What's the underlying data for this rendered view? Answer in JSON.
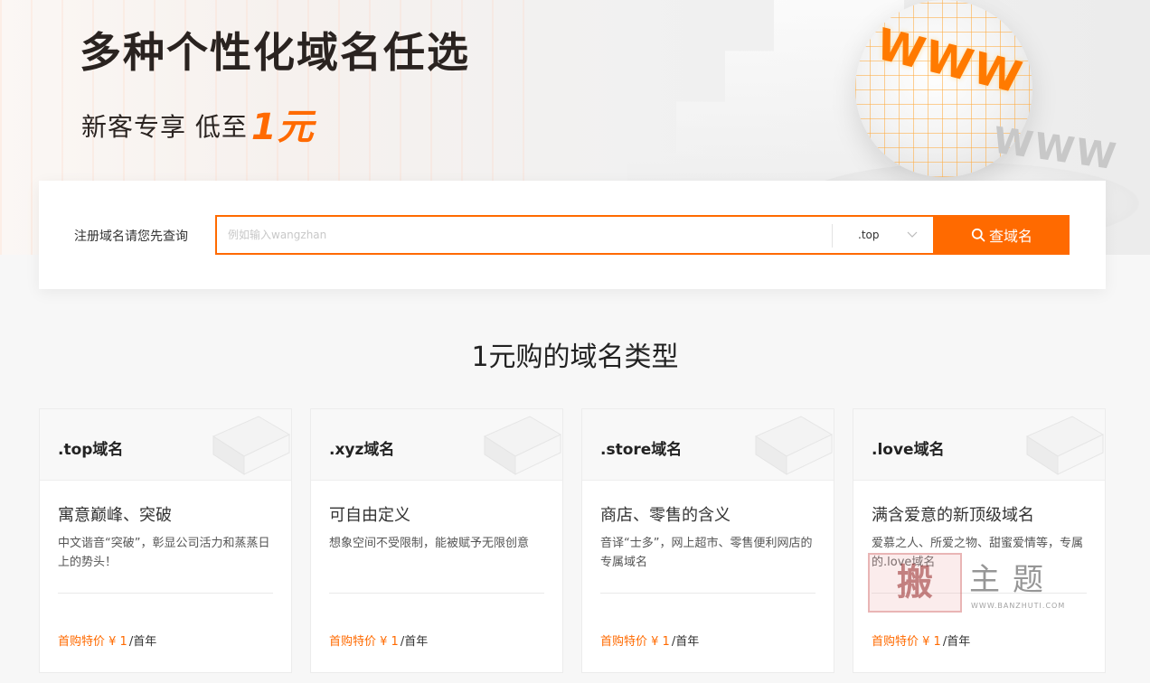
{
  "hero": {
    "title": "多种个性化域名任选",
    "subtitle": "新客专享 低至",
    "price_highlight": "1元",
    "graphic_text": "WWW",
    "graphic_text_shadow": "WWW"
  },
  "search": {
    "label": "注册域名请您先查询",
    "placeholder": "例如输入wangzhan",
    "value": "",
    "suffix": ".top",
    "button_label": "查域名"
  },
  "section": {
    "title": "1元购的域名类型"
  },
  "cards": [
    {
      "name": ".top域名",
      "headline": "寓意巅峰、突破",
      "desc": "中文谐音“突破”，彰显公司活力和蒸蒸日上的势头！",
      "price_label": "首购特价 ¥ 1",
      "price_unit": "/首年"
    },
    {
      "name": ".xyz域名",
      "headline": "可自由定义",
      "desc": "想象空间不受限制，能被赋予无限创意",
      "price_label": "首购特价 ¥ 1",
      "price_unit": "/首年"
    },
    {
      "name": ".store域名",
      "headline": "商店、零售的含义",
      "desc": "音译“士多”，网上超市、零售便利网店的专属域名",
      "price_label": "首购特价 ¥ 1",
      "price_unit": "/首年"
    },
    {
      "name": ".love域名",
      "headline": "满含爱意的新顶级域名",
      "desc": "爱慕之人、所爱之物、甜蜜爱情等，专属的.love域名",
      "price_label": "首购特价 ¥ 1",
      "price_unit": "/首年"
    }
  ],
  "watermark": {
    "seal": "搬",
    "text": "主题",
    "url": "WWW.BANZHUTI.COM"
  },
  "colors": {
    "accent": "#ff6a00",
    "page_background": "#f7f7f7",
    "card_background": "#ffffff"
  },
  "icons": {
    "search_button": "search-icon",
    "suffix_select": "chevron-down-icon"
  }
}
